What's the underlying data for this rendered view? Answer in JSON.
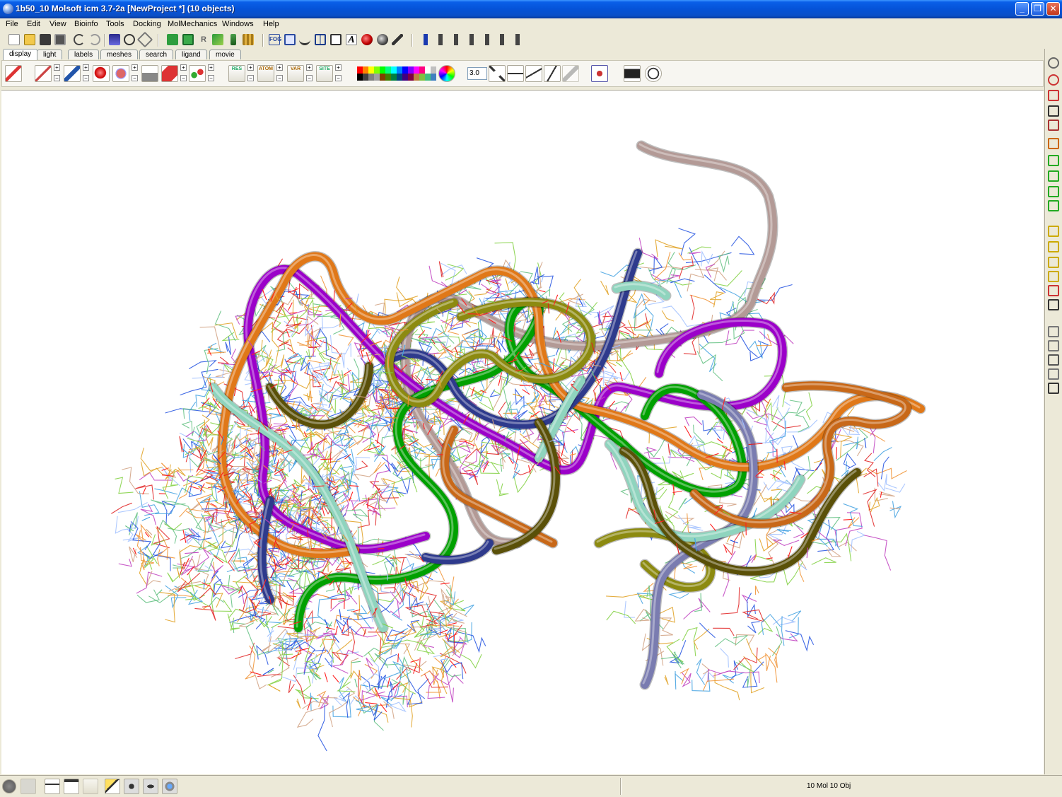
{
  "window": {
    "title": "1b50_10 Molsoft icm 3.7-2a  [NewProject *] (10 objects)"
  },
  "window_buttons": {
    "minimize": "_",
    "maximize": "❐",
    "close": "✕"
  },
  "menu": [
    "File",
    "Edit",
    "View",
    "Bioinfo",
    "Tools",
    "Docking",
    "MolMechanics",
    "Windows",
    "Help"
  ],
  "tabs": [
    "display",
    "light",
    "labels",
    "meshes",
    "search",
    "ligand",
    "movie"
  ],
  "active_tab": "display",
  "display_toolbar": {
    "res_label": "RES",
    "atom_label": "ATOM",
    "var_label": "VAR",
    "site_label": "SITE",
    "label_size": "3.0",
    "plus": "+",
    "minus": "−"
  },
  "status": {
    "text": "10 Mol 10 Obj"
  },
  "palette": [
    "#ff0000",
    "#ff8000",
    "#ffff00",
    "#80ff00",
    "#00ff00",
    "#00ff80",
    "#00ffff",
    "#0080ff",
    "#0000ff",
    "#8000ff",
    "#ff00ff",
    "#ff0080",
    "#ffffff",
    "#c0c0c0",
    "#000000",
    "#404040",
    "#808080",
    "#a0a0a0",
    "#804000",
    "#408000",
    "#008040",
    "#004080",
    "#400080",
    "#800040",
    "#c08040",
    "#80c040",
    "#40c080",
    "#4080c0"
  ],
  "icons": {
    "toolbar1": [
      "new-file-icon",
      "open-icon",
      "save-icon",
      "save-all-icon",
      "undo-icon",
      "redo-icon",
      "pdb-icon",
      "binoculars-icon",
      "ligand-icon",
      "select-icon",
      "copy-icon",
      "r-icon",
      "connect-icon",
      "bond-icon",
      "grid-icon",
      "fog-icon",
      "stereo-icon",
      "glasses-icon",
      "split-icon",
      "frame-icon",
      "font-icon",
      "sphere-icon",
      "shade-icon",
      "tools-icon",
      "align-top-icon",
      "align-2-icon",
      "align-3-icon",
      "align-4-icon",
      "align-5-icon",
      "align-bottom-icon"
    ],
    "rightbar": [
      "target-icon",
      "rotate-icon",
      "translate-icon",
      "zoom-icon",
      "spin-icon",
      "lock-icon",
      "select-box-icon",
      "sphere-select-icon",
      "check-icon",
      "as-icon",
      "clip-front-icon",
      "clip-back-icon",
      "clip-both-icon",
      "clip-slab-icon",
      "fog-clip-icon",
      "padlock-icon",
      "rotate-x-icon",
      "rotate-z-icon",
      "move-icon",
      "esc-icon",
      "hand-icon"
    ],
    "statusbar": [
      "close-circle-icon",
      "sixty-icon",
      "workspace-icon",
      "window-icon",
      "panel-icon",
      "layers-icon",
      "camera-icon",
      "eye-icon",
      "gear-icon"
    ]
  },
  "strand_colors": [
    "#B39A96",
    "#9B00C9",
    "#00A000",
    "#E07818",
    "#2E3A8C",
    "#8C8A10",
    "#7A7CB0",
    "#8FD4BE",
    "#C86818",
    "#5A5008"
  ]
}
